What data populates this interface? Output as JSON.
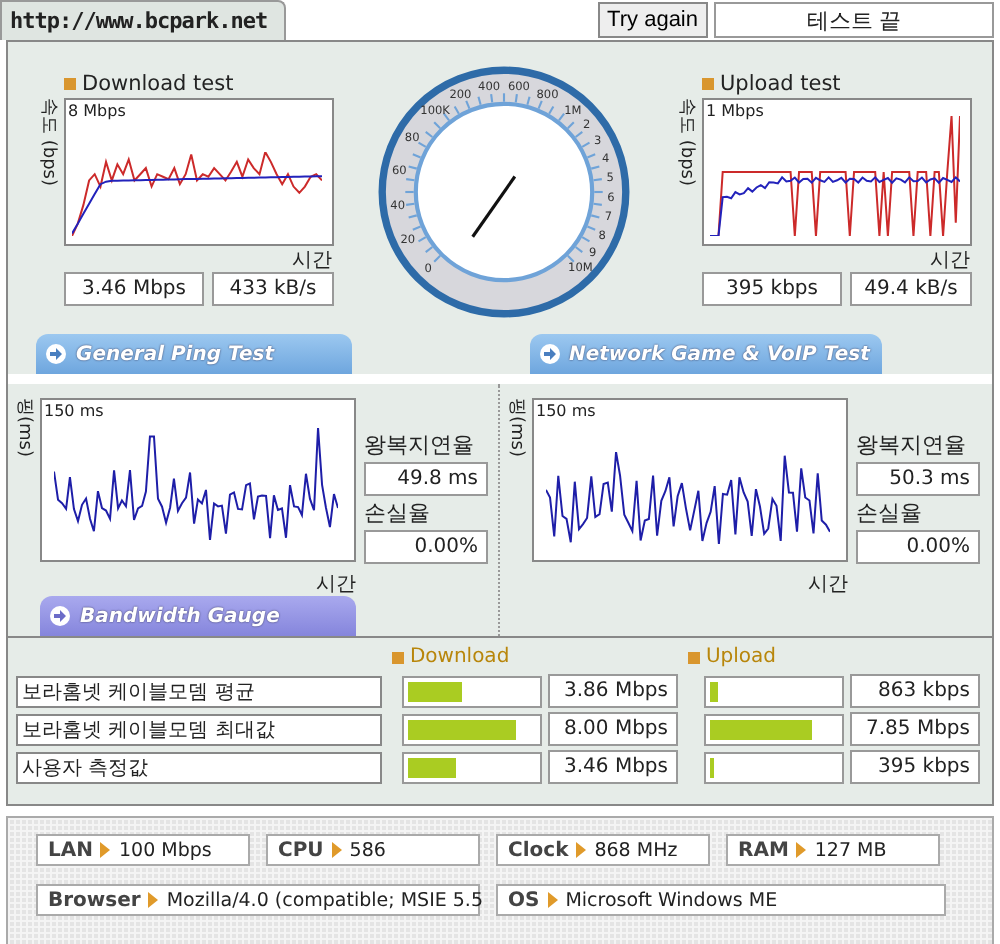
{
  "header": {
    "site_tab": "http://www.bcpark.net",
    "retry_button": "Try again",
    "status": "테스트 끝"
  },
  "speed_tests": [
    {
      "title": "Download test",
      "y_label": "속도 (bps)",
      "scale": "8 Mbps",
      "x_label": "시간",
      "readings": [
        "3.46 Mbps",
        "433 kB/s"
      ]
    },
    {
      "title": "Upload test",
      "y_label": "속도 (bps)",
      "scale": "1 Mbps",
      "x_label": "시간",
      "readings": [
        "395 kbps",
        "49.4 kB/s"
      ]
    }
  ],
  "gauge": {
    "labels": [
      "0",
      "20",
      "40",
      "60",
      "80",
      "100K",
      "200",
      "400",
      "600",
      "800",
      "1M",
      "2",
      "3",
      "4",
      "5",
      "6",
      "7",
      "8",
      "9",
      "10M"
    ]
  },
  "ping_tests": [
    {
      "tab": "General Ping Test",
      "y_label": "핑(ms)",
      "scale": "150 ms",
      "x_label": "시간",
      "latency_label": "왕복지연율",
      "latency": "49.8 ms",
      "loss_label": "손실율",
      "loss": "0.00%"
    },
    {
      "tab": "Network Game & VoIP Test",
      "y_label": "핑(ms)",
      "scale": "150 ms",
      "x_label": "시간",
      "latency_label": "왕복지연율",
      "latency": "50.3 ms",
      "loss_label": "손실율",
      "loss": "0.00%"
    }
  ],
  "bandwidth": {
    "tab": "Bandwidth Gauge",
    "download_label": "Download",
    "upload_label": "Upload",
    "rows": [
      {
        "name": "보라홈넷 케이블모뎀 평균",
        "download": {
          "level": 0.42,
          "value": "3.86 Mbps"
        },
        "upload": {
          "level": 0.07,
          "value": "863 kbps"
        }
      },
      {
        "name": "보라홈넷 케이블모뎀 최대값",
        "download": {
          "level": 0.84,
          "value": "8.00 Mbps"
        },
        "upload": {
          "level": 0.8,
          "value": "7.85 Mbps"
        }
      },
      {
        "name": "사용자 측정값",
        "download": {
          "level": 0.37,
          "value": "3.46 Mbps"
        },
        "upload": {
          "level": 0.03,
          "value": "395 kbps"
        }
      }
    ]
  },
  "system_info": [
    [
      {
        "label": "LAN",
        "value": "100 Mbps"
      },
      {
        "label": "CPU",
        "value": "586"
      },
      {
        "label": "Clock",
        "value": "868 MHz"
      },
      {
        "label": "RAM",
        "value": "127 MB"
      }
    ],
    [
      {
        "label": "Browser",
        "value": "Mozilla/4.0 (compatible; MSIE 5.5"
      },
      {
        "label": "OS",
        "value": "Microsoft Windows ME"
      }
    ]
  ]
}
